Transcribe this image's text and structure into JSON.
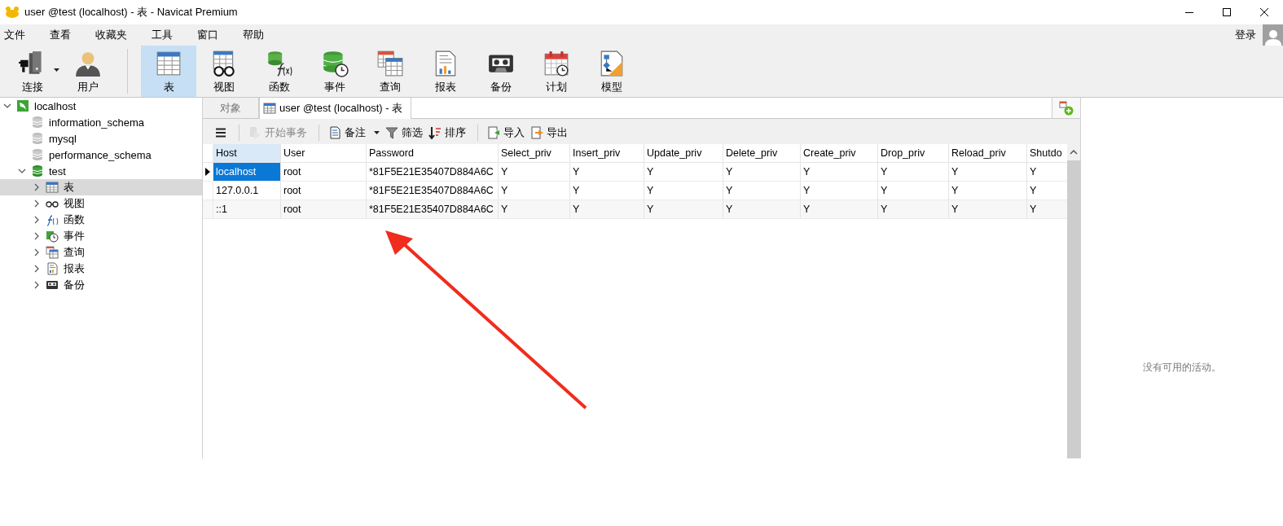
{
  "window": {
    "title": "user @test (localhost) - 表 - Navicat Premium"
  },
  "menu": [
    "文件",
    "查看",
    "收藏夹",
    "工具",
    "窗口",
    "帮助"
  ],
  "account": {
    "label": "登录"
  },
  "toolbar": [
    [
      {
        "kind": "connection",
        "label": "连接",
        "dropdown": true,
        "selected": false
      },
      {
        "kind": "user",
        "label": "用户",
        "dropdown": false,
        "selected": false
      }
    ],
    [
      {
        "kind": "table",
        "label": "表",
        "dropdown": false,
        "selected": true
      },
      {
        "kind": "view",
        "label": "视图",
        "dropdown": false,
        "selected": false
      },
      {
        "kind": "function",
        "label": "函数",
        "dropdown": false,
        "selected": false
      },
      {
        "kind": "event",
        "label": "事件",
        "dropdown": false,
        "selected": false
      },
      {
        "kind": "query",
        "label": "查询",
        "dropdown": false,
        "selected": false
      },
      {
        "kind": "report",
        "label": "报表",
        "dropdown": false,
        "selected": false
      },
      {
        "kind": "backup",
        "label": "备份",
        "dropdown": false,
        "selected": false
      },
      {
        "kind": "schedule",
        "label": "计划",
        "dropdown": false,
        "selected": false
      },
      {
        "kind": "model",
        "label": "模型",
        "dropdown": false,
        "selected": false
      }
    ]
  ],
  "sidebar": {
    "tree": [
      {
        "kind": "server",
        "label": "localhost",
        "expanded": true,
        "selected": false,
        "children": [
          {
            "kind": "db",
            "label": "information_schema",
            "selected": false
          },
          {
            "kind": "db",
            "label": "mysql",
            "selected": false
          },
          {
            "kind": "db",
            "label": "performance_schema",
            "selected": false
          },
          {
            "kind": "db-open",
            "label": "test",
            "expanded": true,
            "selected": false,
            "children": [
              {
                "kind": "table",
                "label": "表",
                "expanded": false,
                "selected": true
              },
              {
                "kind": "view",
                "label": "视图",
                "expanded": false,
                "selected": false
              },
              {
                "kind": "function",
                "label": "函数",
                "expanded": false,
                "selected": false
              },
              {
                "kind": "event",
                "label": "事件",
                "expanded": false,
                "selected": false
              },
              {
                "kind": "query",
                "label": "查询",
                "expanded": false,
                "selected": false
              },
              {
                "kind": "report",
                "label": "报表",
                "expanded": false,
                "selected": false
              },
              {
                "kind": "backup",
                "label": "备份",
                "expanded": false,
                "selected": false
              }
            ]
          }
        ]
      }
    ]
  },
  "tabs": [
    {
      "kind": "objects",
      "label": "对象",
      "selected": false
    },
    {
      "kind": "table",
      "label": "user @test (localhost) - 表",
      "selected": true
    }
  ],
  "actions": [
    [
      {
        "kind": "menu",
        "disabled": false
      }
    ],
    [
      {
        "kind": "transaction",
        "label": "开始事务",
        "disabled": true
      }
    ],
    [
      {
        "kind": "note",
        "label": "备注",
        "dropdown": true,
        "disabled": false
      },
      {
        "kind": "filter",
        "label": "筛选",
        "disabled": false
      },
      {
        "kind": "sort",
        "label": "排序",
        "disabled": false
      }
    ],
    [
      {
        "kind": "import",
        "label": "导入",
        "disabled": false
      },
      {
        "kind": "export",
        "label": "导出",
        "disabled": false
      }
    ]
  ],
  "table": {
    "columns": [
      "Host",
      "User",
      "Password",
      "Select_priv",
      "Insert_priv",
      "Update_priv",
      "Delete_priv",
      "Create_priv",
      "Drop_priv",
      "Reload_priv",
      "Shutdo"
    ],
    "rows": [
      {
        "selected": true,
        "cells": [
          "localhost",
          "root",
          "*81F5E21E35407D884A6C",
          "Y",
          "Y",
          "Y",
          "Y",
          "Y",
          "Y",
          "Y",
          "Y"
        ]
      },
      {
        "selected": false,
        "cells": [
          "127.0.0.1",
          "root",
          "*81F5E21E35407D884A6C",
          "Y",
          "Y",
          "Y",
          "Y",
          "Y",
          "Y",
          "Y",
          "Y"
        ]
      },
      {
        "selected": false,
        "cells": [
          "::1",
          "root",
          "*81F5E21E35407D884A6C",
          "Y",
          "Y",
          "Y",
          "Y",
          "Y",
          "Y",
          "Y",
          "Y"
        ]
      }
    ]
  },
  "activity": {
    "message": "没有可用的活动。"
  },
  "annotations": [
    {
      "kind": "arrow"
    }
  ]
}
